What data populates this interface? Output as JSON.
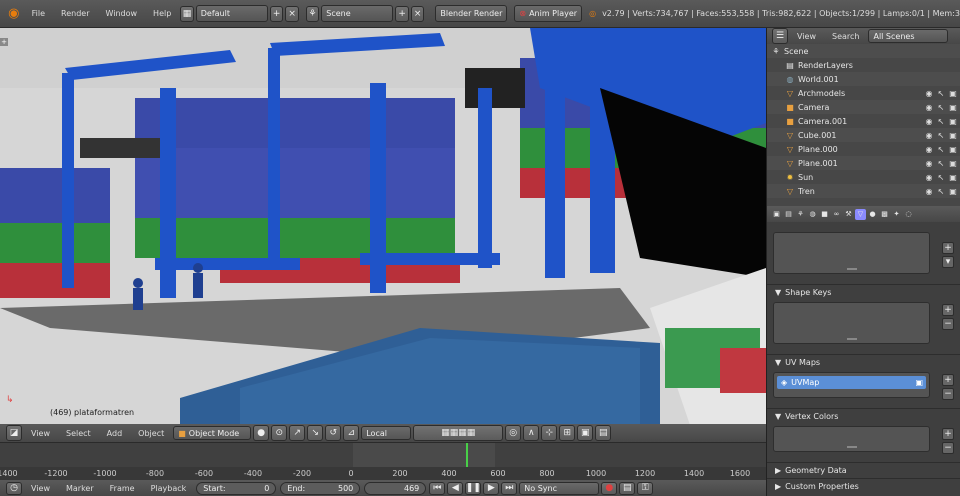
{
  "top": {
    "menus": [
      "File",
      "Render",
      "Window",
      "Help"
    ],
    "layout": "Default",
    "scene": "Scene",
    "engine": "Blender Render",
    "anim_player": "Anim Player",
    "stats": "v2.79 | Verts:734,767 | Faces:553,558 | Tris:982,622 | Objects:1/299 | Lamps:0/1 | Mem:3"
  },
  "viewport": {
    "object_label": "(469) plataformatren"
  },
  "outliner": {
    "menus": [
      "View",
      "Search"
    ],
    "filter": "All Scenes",
    "rows": [
      "Scene",
      "RenderLayers",
      "World.001",
      "Archmodels",
      "Camera",
      "Camera.001",
      "Cube.001",
      "Plane.000",
      "Plane.001",
      "Sun",
      "Tren"
    ]
  },
  "properties": {
    "panels": {
      "shape_keys": "Shape Keys",
      "uv_maps": "UV Maps",
      "vertex_colors": "Vertex Colors",
      "geometry_data": "Geometry Data",
      "custom_properties": "Custom Properties"
    },
    "uv_item": "UVMap"
  },
  "vp_header": {
    "menus": [
      "View",
      "Select",
      "Add",
      "Object"
    ],
    "mode": "Object Mode",
    "orientation": "Local"
  },
  "timeline": {
    "ticks": [
      "-1400",
      "-1200",
      "-1000",
      "-800",
      "-600",
      "-400",
      "-200",
      "0",
      "200",
      "400",
      "600",
      "800",
      "1000",
      "1200",
      "1400",
      "1600"
    ]
  },
  "bottom": {
    "menus": [
      "View",
      "Marker",
      "Frame",
      "Playback"
    ],
    "start_label": "Start:",
    "start": "0",
    "end_label": "End:",
    "end": "500",
    "current": "469",
    "sync": "No Sync"
  },
  "colors": {
    "container_blue": "#3a4aa8",
    "container_green": "#2f8f3c",
    "container_red": "#b8303a",
    "crane_blue": "#1f53c8",
    "water": "#2f5f96",
    "ground": "#d8d8d8"
  }
}
